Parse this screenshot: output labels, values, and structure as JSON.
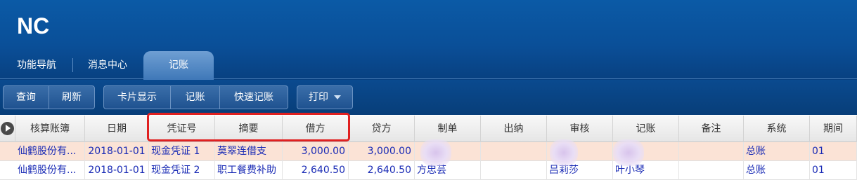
{
  "app": {
    "logo_text": "NC"
  },
  "tabs": [
    {
      "label": "功能导航"
    },
    {
      "label": "消息中心"
    },
    {
      "label": "记账"
    }
  ],
  "toolbar": {
    "group1": [
      "查询",
      "刷新"
    ],
    "group2": [
      "卡片显示",
      "记账",
      "快速记账"
    ],
    "print_label": "打印"
  },
  "table": {
    "columns": [
      "核算账簿",
      "日期",
      "凭证号",
      "摘要",
      "借方",
      "贷方",
      "制单",
      "出纳",
      "审核",
      "记账",
      "备注",
      "系统",
      "期间"
    ],
    "rows": [
      {
        "book": "仙鹤股份有...",
        "date": "2018-01-01",
        "voucher": "现金凭证  1",
        "summary": "莫翠连借支",
        "debit": "3,000.00",
        "credit": "3,000.00",
        "maker": "",
        "cashier": "",
        "auditor": "",
        "poster": "",
        "note": "",
        "system": "总账",
        "period": "01"
      },
      {
        "book": "仙鹤股份有...",
        "date": "2018-01-01",
        "voucher": "现金凭证  2",
        "summary": "职工餐费补助",
        "debit": "2,640.50",
        "credit": "2,640.50",
        "maker": "方忠芸",
        "cashier": "",
        "auditor": "吕莉莎",
        "poster": "叶小琴",
        "note": "",
        "system": "总账",
        "period": "01"
      }
    ]
  },
  "colors": {
    "header_blue": "#0a4f98",
    "highlight_red": "#e02020",
    "selected_row": "#fbe3d6",
    "cell_text": "#1a2bb5"
  }
}
